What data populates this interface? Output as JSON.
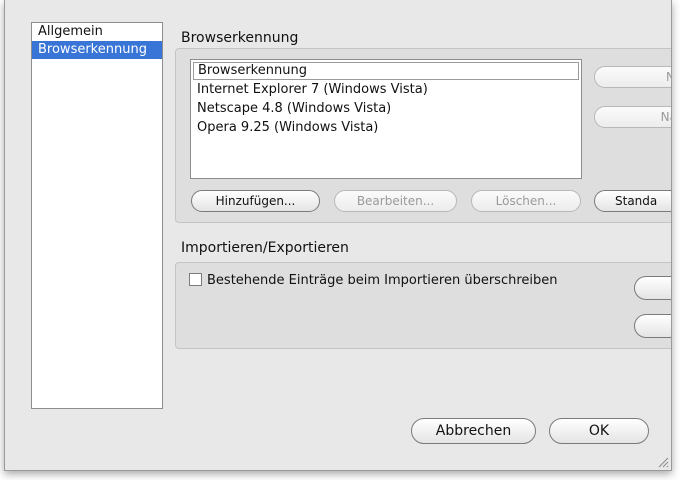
{
  "sidebar": {
    "items": [
      {
        "label": "Allgemein",
        "selected": false
      },
      {
        "label": "Browserkennung",
        "selected": true
      }
    ]
  },
  "browser_section": {
    "heading": "Browserkennung",
    "list_items": [
      {
        "label": "Browserkennung",
        "selected": true
      },
      {
        "label": "Internet Explorer 7 (Windows Vista)",
        "selected": false
      },
      {
        "label": "Netscape 4.8 (Windows Vista)",
        "selected": false
      },
      {
        "label": "Opera 9.25 (Windows Vista)",
        "selected": false
      }
    ],
    "side_buttons": [
      {
        "label": "N",
        "enabled": false
      },
      {
        "label": "Na",
        "enabled": false
      }
    ],
    "buttons": {
      "add": "Hinzufügen...",
      "edit": "Bearbeiten...",
      "delete": "Löschen...",
      "default": "Standa"
    }
  },
  "import_section": {
    "heading": "Importieren/Exportieren",
    "overwrite_checkbox": {
      "label": "Bestehende Einträge beim Importieren überschreiben",
      "checked": false
    }
  },
  "footer": {
    "cancel": "Abbrechen",
    "ok": "OK"
  },
  "colors": {
    "selection": "#3875d7",
    "dialog_background": "#e8e8e8"
  }
}
